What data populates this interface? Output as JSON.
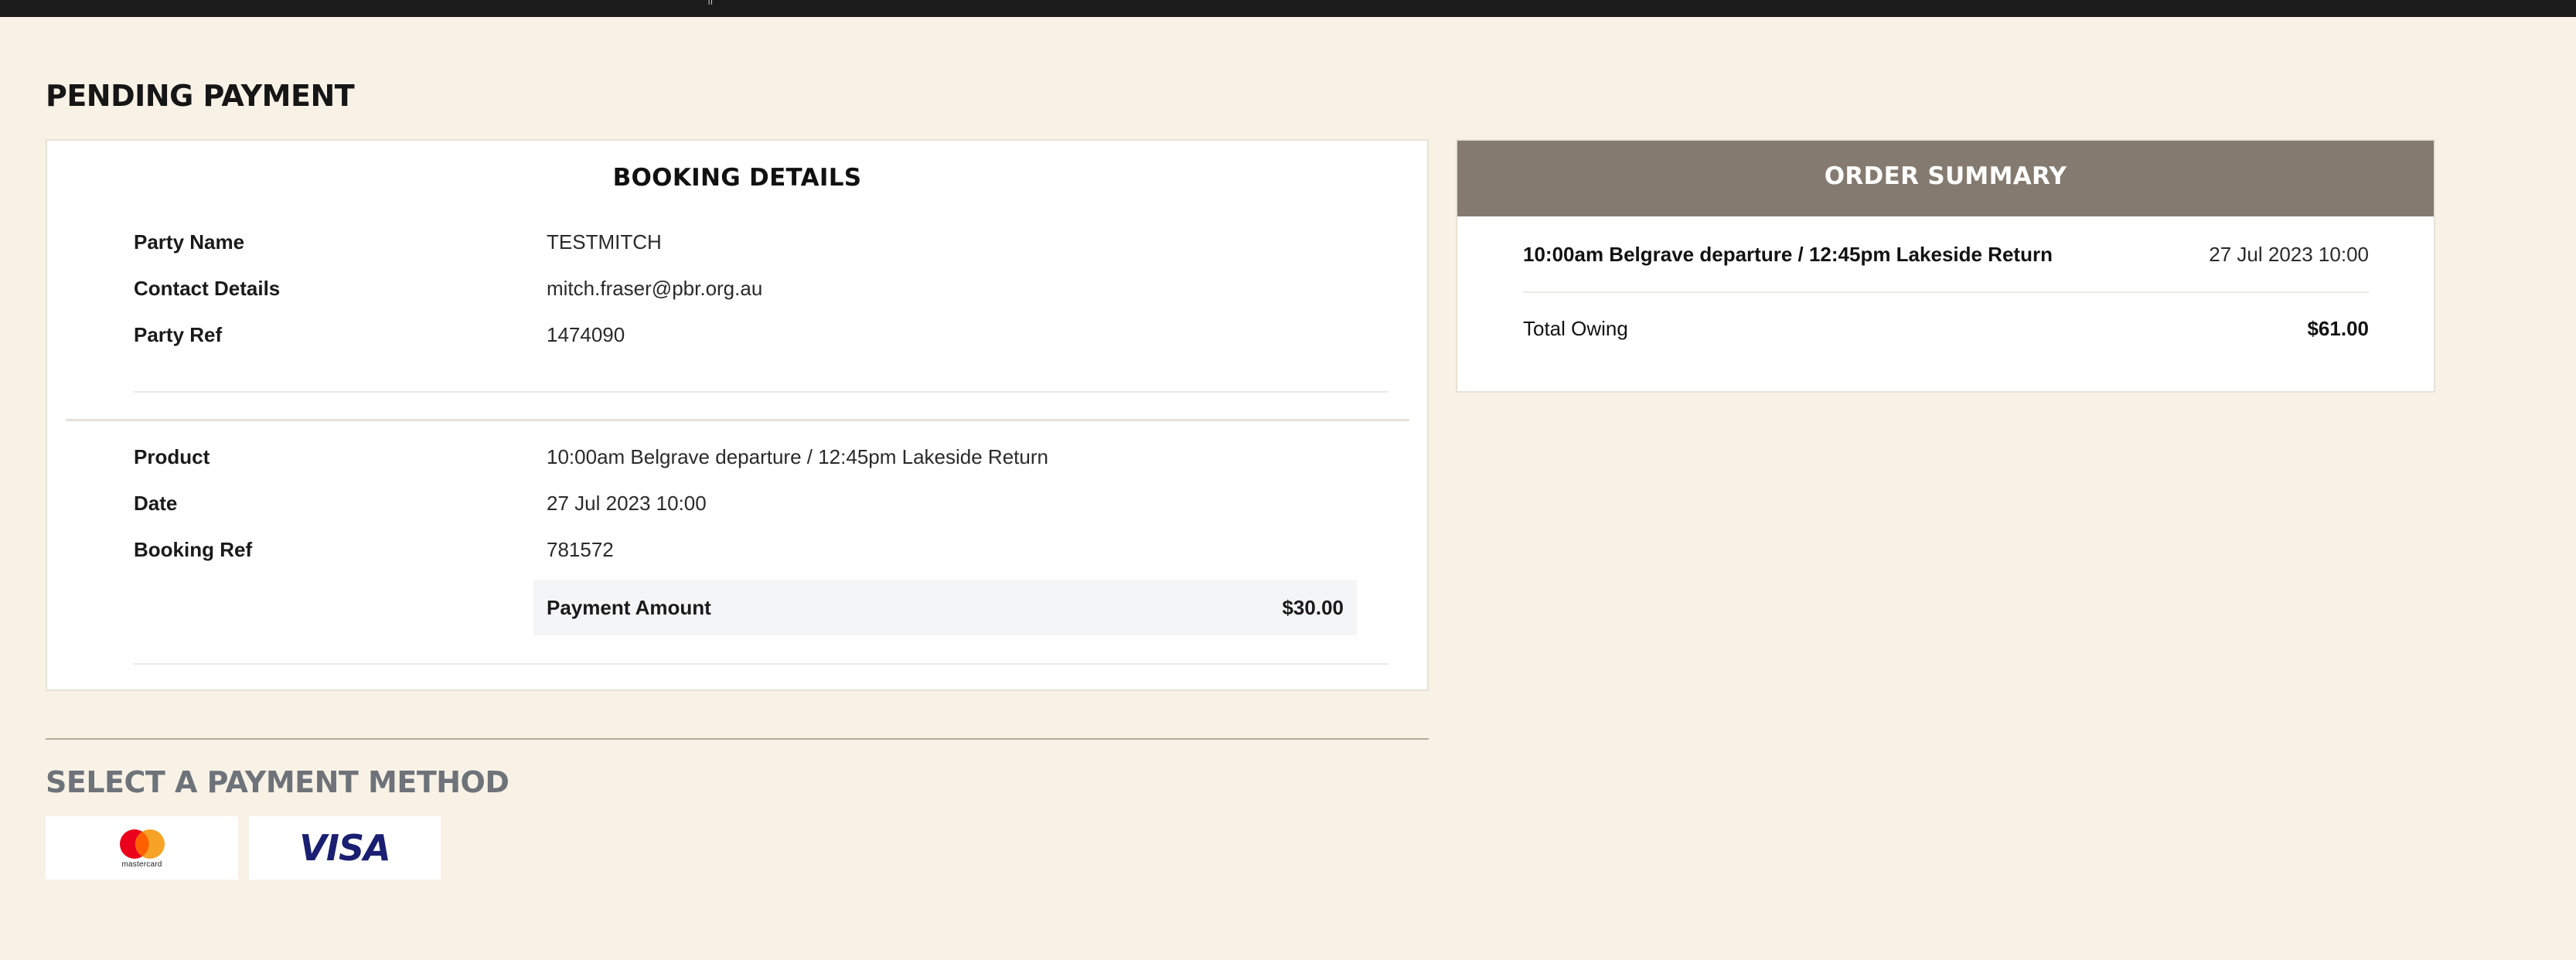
{
  "topbar": {
    "mark": "ᥬᥬ"
  },
  "page": {
    "title": "PENDING PAYMENT"
  },
  "booking": {
    "title": "BOOKING DETAILS",
    "party": [
      {
        "label": "Party Name",
        "value": "TESTMITCH"
      },
      {
        "label": "Contact Details",
        "value": "mitch.fraser@pbr.org.au"
      },
      {
        "label": "Party Ref",
        "value": "1474090"
      }
    ],
    "item": [
      {
        "label": "Product",
        "value": "10:00am Belgrave departure / 12:45pm Lakeside Return"
      },
      {
        "label": "Date",
        "value": "27 Jul 2023 10:00"
      },
      {
        "label": "Booking Ref",
        "value": "781572"
      }
    ],
    "payment_amount": {
      "label": "Payment Amount",
      "value": "$30.00"
    }
  },
  "summary": {
    "title": "ORDER SUMMARY",
    "line": {
      "label": "10:00am Belgrave departure / 12:45pm Lakeside Return",
      "value": "27 Jul 2023 10:00"
    },
    "total": {
      "label": "Total Owing",
      "value": "$61.00"
    }
  },
  "payment_methods": {
    "title": "SELECT A PAYMENT METHOD",
    "mastercard": {
      "icon": "mastercard-logo",
      "text": "mastercard"
    },
    "visa": {
      "icon": "visa-logo",
      "text": "VISA"
    }
  },
  "colors": {
    "background": "#f8f2e6",
    "summary_header": "#847a6f",
    "visa_blue": "#1a1f71",
    "mc_red": "#eb001b",
    "mc_orange": "#f79e1b"
  }
}
